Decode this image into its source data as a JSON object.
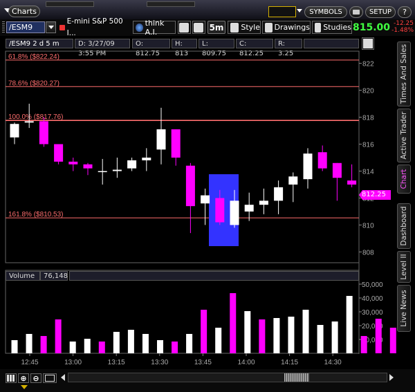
{
  "app": {
    "title": "Charts",
    "symbols_label": "SYMBOLS",
    "setup_label": "SETUP"
  },
  "toolbar": {
    "symbol": "/ESM9",
    "description": "E-mini S&P 500 I...",
    "think_label": "think A.I.",
    "timeframe": "5m",
    "style_label": "Style",
    "drawings_label": "Drawings",
    "studies_label": "Studies",
    "last_price": "815.00",
    "net_change": "-12.25",
    "pct_change": "-1.48%"
  },
  "price_header": {
    "label": "/ESM9 2 d 5 m",
    "date": "D: 3/27/09 3:55 PM",
    "open": "O: 812.75",
    "high": "H: 813",
    "low": "L: 809.75",
    "close": "C: 812.25",
    "range": "R: 3.25"
  },
  "fib_lines": [
    {
      "label": "61.8% ($822.24)",
      "price": 822.24
    },
    {
      "label": "78.6% ($820.27)",
      "price": 820.27
    },
    {
      "label": "100.0% ($817.76)",
      "price": 817.76
    },
    {
      "label": "161.8% ($810.53)",
      "price": 810.53
    }
  ],
  "price_axis": {
    "ticks": [
      "822",
      "820",
      "818",
      "816",
      "814",
      "812",
      "810",
      "808"
    ],
    "min": 807.2,
    "max": 822.9,
    "current_label": "812.25"
  },
  "volume_header": {
    "label": "Volume",
    "value": "76,148"
  },
  "volume_axis": {
    "ticks": [
      "50,000",
      "40,000",
      "30,000",
      "20,000",
      "10,000"
    ],
    "max": 51000
  },
  "time_labels": [
    "12:45",
    "13:00",
    "13:15",
    "13:30",
    "13:45",
    "14:00",
    "14:15",
    "14:30"
  ],
  "side_tabs": [
    "Times And Sales",
    "Active Trader",
    "Chart",
    "Dashboard",
    "Level II",
    "Live News"
  ],
  "colors": {
    "up": "#ffffff",
    "down": "#ff00ff",
    "fib": "#ff6e6e",
    "highlight": "#3333ff"
  },
  "chart_data": {
    "type": "candlestick",
    "candles": [
      {
        "t": "12:35",
        "o": 816.5,
        "h": 817.6,
        "l": 816.0,
        "c": 817.5
      },
      {
        "t": "12:40",
        "o": 817.6,
        "h": 819.0,
        "l": 817.2,
        "c": 817.7
      },
      {
        "t": "12:45",
        "o": 817.7,
        "h": 818.0,
        "l": 815.8,
        "c": 816.0
      },
      {
        "t": "12:50",
        "o": 816.0,
        "h": 816.0,
        "l": 814.5,
        "c": 814.7
      },
      {
        "t": "12:55",
        "o": 814.7,
        "h": 815.0,
        "l": 814.0,
        "c": 814.5
      },
      {
        "t": "13:00",
        "o": 814.5,
        "h": 814.6,
        "l": 813.7,
        "c": 814.2
      },
      {
        "t": "13:05",
        "o": 814.0,
        "h": 814.9,
        "l": 813.0,
        "c": 814.0
      },
      {
        "t": "13:10",
        "o": 814.0,
        "h": 815.0,
        "l": 813.5,
        "c": 814.1
      },
      {
        "t": "13:15",
        "o": 814.2,
        "h": 815.0,
        "l": 814.0,
        "c": 814.8
      },
      {
        "t": "13:20",
        "o": 814.8,
        "h": 815.7,
        "l": 814.0,
        "c": 815.0
      },
      {
        "t": "13:25",
        "o": 815.6,
        "h": 818.7,
        "l": 814.5,
        "c": 817.1
      },
      {
        "t": "13:30",
        "o": 817.1,
        "h": 817.1,
        "l": 814.4,
        "c": 815.0
      },
      {
        "t": "13:35",
        "o": 814.4,
        "h": 814.6,
        "l": 809.4,
        "c": 811.4
      },
      {
        "t": "13:40",
        "o": 811.6,
        "h": 812.7,
        "l": 810.0,
        "c": 812.2
      },
      {
        "t": "13:45",
        "o": 812.0,
        "h": 812.6,
        "l": 810.0,
        "c": 810.2
      },
      {
        "t": "13:50",
        "o": 810.0,
        "h": 812.6,
        "l": 809.8,
        "c": 811.8
      },
      {
        "t": "13:55",
        "o": 811.0,
        "h": 812.4,
        "l": 810.3,
        "c": 811.5
      },
      {
        "t": "14:00",
        "o": 811.5,
        "h": 812.7,
        "l": 810.8,
        "c": 811.8
      },
      {
        "t": "14:05",
        "o": 811.8,
        "h": 813.3,
        "l": 810.8,
        "c": 812.8
      },
      {
        "t": "14:10",
        "o": 813.0,
        "h": 813.9,
        "l": 811.7,
        "c": 813.6
      },
      {
        "t": "14:15",
        "o": 813.4,
        "h": 815.7,
        "l": 812.7,
        "c": 815.3
      },
      {
        "t": "14:20",
        "o": 815.4,
        "h": 815.9,
        "l": 814.0,
        "c": 814.2
      },
      {
        "t": "14:25",
        "o": 814.6,
        "h": 814.6,
        "l": 811.8,
        "c": 813.5
      },
      {
        "t": "14:30",
        "o": 813.3,
        "h": 814.5,
        "l": 812.8,
        "c": 813.0
      }
    ],
    "volume": [
      9500,
      14000,
      12500,
      24500,
      8500,
      10500,
      8500,
      15500,
      17000,
      14000,
      9500,
      8500,
      14000,
      31500,
      18500,
      43500,
      30500,
      24500,
      25500,
      26500,
      31500,
      20500,
      23000,
      41500,
      12500,
      25000,
      18500
    ]
  }
}
